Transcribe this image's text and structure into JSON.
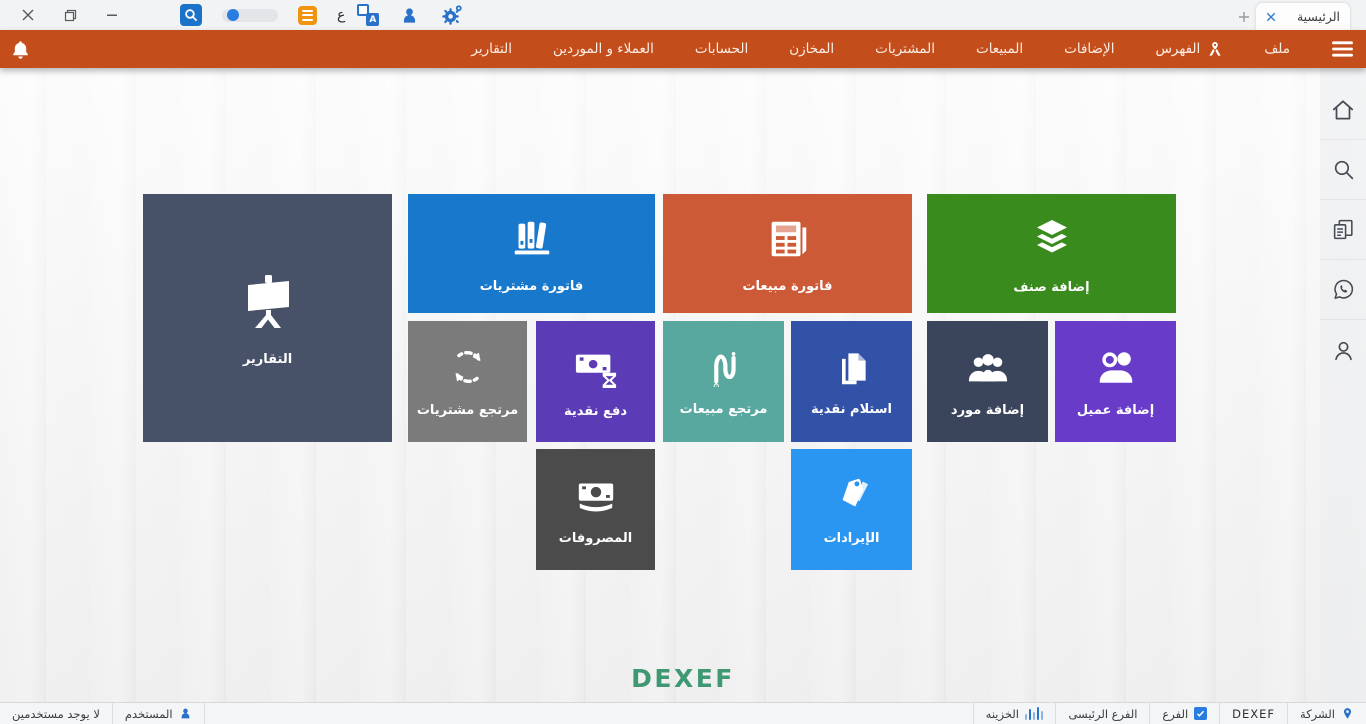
{
  "titlebar": {
    "tab": {
      "label": "الرئيسية"
    },
    "language_letter": "ع",
    "translate_letter": "A",
    "icons": [
      "close-icon",
      "restore-icon",
      "minimize-icon",
      "search-icon",
      "toggle-switch",
      "list-icon",
      "translate-icon",
      "user-icon",
      "settings-gear-icon",
      "new-tab-plus-icon",
      "tab-close-icon"
    ]
  },
  "menu": {
    "bell_icon": "bell-icon",
    "hamburger_icon": "hamburger-icon",
    "ribbon_icon": "ribbon-icon",
    "items": [
      "ملف",
      "الفهرس",
      "الإضافات",
      "المبيعات",
      "المشتريات",
      "المخازن",
      "الحسابات",
      "العملاء و الموردين",
      "التقارير"
    ]
  },
  "sidebar": {
    "icons": [
      "home-icon",
      "search-icon",
      "copy-documents-icon",
      "whatsapp-icon",
      "person-icon"
    ]
  },
  "tiles": [
    {
      "label": "التقارير",
      "color": "#475269",
      "icon": "presentation-easel-icon"
    },
    {
      "label": "فاتورة مشتريات",
      "color": "#1878cb",
      "icon": "books-shelf-icon"
    },
    {
      "label": "فاتورة مبيعات",
      "color": "#cd5a36",
      "icon": "invoice-icon"
    },
    {
      "label": "إضافة صنف",
      "color": "#3a8b1e",
      "icon": "layers-icon"
    },
    {
      "label": "مرتجع مشتريات",
      "color": "#7b7b7b",
      "icon": "refresh-arrows-icon"
    },
    {
      "label": "دفع نقدية",
      "color": "#5c3bb6",
      "icon": "cash-hourglass-icon"
    },
    {
      "label": "مرتجع مبيعات",
      "color": "#58a89f",
      "icon": "squiggle-route-icon"
    },
    {
      "label": "استلام نقدية",
      "color": "#3252a8",
      "icon": "documents-icon"
    },
    {
      "label": "إضافة مورد",
      "color": "#3a455c",
      "icon": "people-group-icon"
    },
    {
      "label": "إضافة عميل",
      "color": "#683cc8",
      "icon": "two-people-icon"
    },
    {
      "label": "المصروفات",
      "color": "#4b4b4b",
      "icon": "banknotes-icon"
    },
    {
      "label": "الإيرادات",
      "color": "#2b96f1",
      "icon": "price-tag-icon"
    }
  ],
  "logo": {
    "text": "DEXEF",
    "color": "#3e9872"
  },
  "statusbar": {
    "no_users": "لا يوجد مستخدمين",
    "user": "المستخدم",
    "company": "الشركة",
    "brand": "DEXEF",
    "branch": "الفرع",
    "main_branch": "الفرع الرئيسى",
    "treasury": "الخزينه",
    "icons": [
      "user-icon",
      "location-pin-icon",
      "checkbox-icon",
      "equalizer-icon"
    ]
  },
  "colors": {
    "menubar_orange": "#c44e1b",
    "accent_blue": "#2a72c8",
    "logo_green": "#3e9872"
  }
}
